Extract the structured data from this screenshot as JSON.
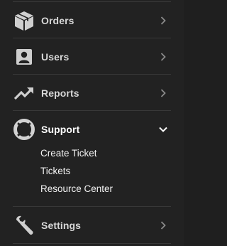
{
  "sidebar": {
    "items": [
      {
        "label": "Orders",
        "icon": "box-icon",
        "chevron": "chevron-right-icon"
      },
      {
        "label": "Users",
        "icon": "user-card-icon",
        "chevron": "chevron-right-icon"
      },
      {
        "label": "Reports",
        "icon": "trend-up-icon",
        "chevron": "chevron-right-icon"
      },
      {
        "label": "Support",
        "icon": "lifebuoy-icon",
        "chevron": "chevron-down-icon",
        "expanded": true,
        "subitems": [
          {
            "label": "Create Ticket"
          },
          {
            "label": "Tickets"
          },
          {
            "label": "Resource Center"
          }
        ]
      },
      {
        "label": "Settings",
        "icon": "wrench-icon",
        "chevron": "chevron-right-icon"
      }
    ]
  },
  "colors": {
    "background": "#222222",
    "text": "#d7d7d7",
    "active_text": "#ffffff",
    "divider": "#383838",
    "icon": "#cfcfcf",
    "chevron": "#8a8a8a"
  }
}
